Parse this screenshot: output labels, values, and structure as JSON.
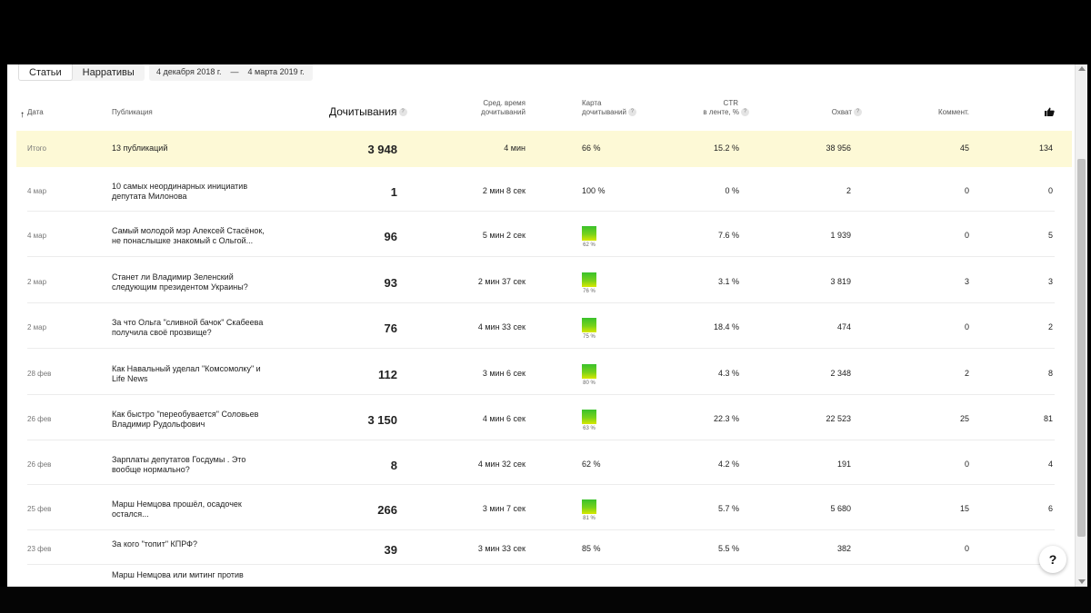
{
  "tabs": [
    "Статьи",
    "Нарративы"
  ],
  "date_range": {
    "from": "4 декабря 2018 г.",
    "sep": "—",
    "to": "4 марта 2019 г."
  },
  "columns": {
    "date": "Дата",
    "publication": "Публикация",
    "reads": "Дочитывания",
    "avg_time_1": "Сред. время",
    "avg_time_2": "дочитываний",
    "map_1": "Карта",
    "map_2": "дочитываний",
    "ctr_1": "CTR",
    "ctr_2": "в ленте, %",
    "reach": "Охват",
    "comments": "Коммент.",
    "likes_icon": "thumbs-up-icon"
  },
  "total": {
    "label": "Итого",
    "publication": "13 публикаций",
    "reads": "3 948",
    "avg_time": "4 мин",
    "map": "66 %",
    "ctr": "15.2 %",
    "reach": "38 956",
    "comments": "45",
    "likes": "134"
  },
  "rows": [
    {
      "date": "4 мар",
      "publication": "10 самых неординарных инициатив депутата Милонова",
      "reads": "1",
      "avg_time": "2 мин 8 сек",
      "map_text": "100 %",
      "map_pct": null,
      "ctr": "0 %",
      "reach": "2",
      "comments": "0",
      "likes": "0"
    },
    {
      "date": "4 мар",
      "publication": "Самый молодой мэр Алексей Стасёнок, не понаслышке знакомый с Ольгой...",
      "reads": "96",
      "avg_time": "5 мин 2 сек",
      "map_text": "",
      "map_pct": "62 %",
      "ctr": "7.6 %",
      "reach": "1 939",
      "comments": "0",
      "likes": "5"
    },
    {
      "date": "2 мар",
      "publication": "Станет ли Владимир Зеленский следующим президентом Украины?",
      "reads": "93",
      "avg_time": "2 мин 37 сек",
      "map_text": "",
      "map_pct": "76 %",
      "ctr": "3.1 %",
      "reach": "3 819",
      "comments": "3",
      "likes": "3"
    },
    {
      "date": "2 мар",
      "publication": "За что Ольга \"сливной бачок\" Скабеева получила своё прозвище?",
      "reads": "76",
      "avg_time": "4 мин 33 сек",
      "map_text": "",
      "map_pct": "75 %",
      "ctr": "18.4 %",
      "reach": "474",
      "comments": "0",
      "likes": "2"
    },
    {
      "date": "28 фев",
      "publication": "Как Навальный уделал \"Комсомолку\" и Life News",
      "reads": "112",
      "avg_time": "3 мин 6 сек",
      "map_text": "",
      "map_pct": "80 %",
      "ctr": "4.3 %",
      "reach": "2 348",
      "comments": "2",
      "likes": "8"
    },
    {
      "date": "26 фев",
      "publication": "Как быстро \"переобувается\" Соловьев Владимир Рудольфович",
      "reads": "3 150",
      "avg_time": "4 мин 6 сек",
      "map_text": "",
      "map_pct": "63 %",
      "ctr": "22.3 %",
      "reach": "22 523",
      "comments": "25",
      "likes": "81"
    },
    {
      "date": "26 фев",
      "publication": "Зарплаты депутатов Госдумы . Это вообще нормально?",
      "reads": "8",
      "avg_time": "4 мин 32 сек",
      "map_text": "62 %",
      "map_pct": null,
      "ctr": "4.2 %",
      "reach": "191",
      "comments": "0",
      "likes": "4"
    },
    {
      "date": "25 фев",
      "publication": "Марш Немцова прошёл, осадочек остался...",
      "reads": "266",
      "avg_time": "3 мин 7 сек",
      "map_text": "",
      "map_pct": "81 %",
      "ctr": "5.7 %",
      "reach": "5 680",
      "comments": "15",
      "likes": "6"
    },
    {
      "date": "23 фев",
      "publication": "За кого \"топит\" КПРФ?",
      "reads": "39",
      "avg_time": "3 мин 33 сек",
      "map_text": "85 %",
      "map_pct": null,
      "ctr": "5.5 %",
      "reach": "382",
      "comments": "0",
      "likes": ""
    },
    {
      "date": "",
      "publication": "Марш Немцова или митинг против",
      "reads": "",
      "avg_time": "",
      "map_text": "",
      "map_pct": null,
      "ctr": "",
      "reach": "",
      "comments": "",
      "likes": ""
    }
  ],
  "help_button": "?"
}
